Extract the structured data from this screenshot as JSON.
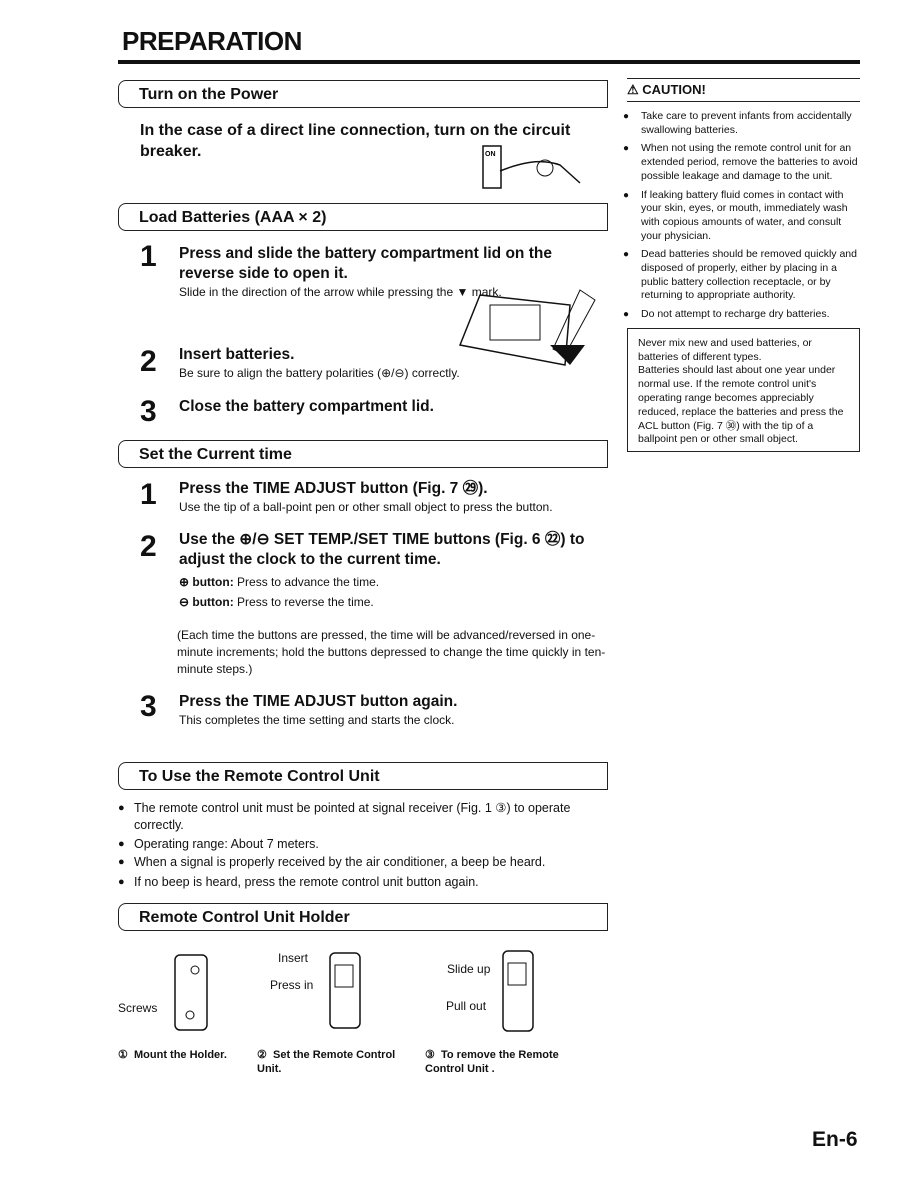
{
  "title": "PREPARATION",
  "power": {
    "header": "Turn on the Power",
    "text": "In the case of a direct line connection, turn on the circuit breaker.",
    "switch_label": "ON"
  },
  "batteries": {
    "header": "Load Batteries (AAA × 2)",
    "steps": [
      {
        "num": "1",
        "title": "Press and slide the battery compartment lid on the reverse side to open it.",
        "desc": "Slide in the direction of the arrow while pressing the ▼ mark."
      },
      {
        "num": "2",
        "title": "Insert batteries.",
        "desc": "Be sure to align the battery polarities (⊕/⊖) correctly."
      },
      {
        "num": "3",
        "title": "Close the battery compartment lid.",
        "desc": ""
      }
    ]
  },
  "time": {
    "header": "Set the Current time",
    "steps": [
      {
        "num": "1",
        "title": "Press the TIME ADJUST button (Fig. 7 ㉙).",
        "desc": "Use the tip of a ball-point pen or other small object to press the button."
      },
      {
        "num": "2",
        "title": "Use the ⊕/⊖ SET TEMP./SET TIME buttons (Fig. 6 ㉒) to adjust the clock to the current time.",
        "plus_label": "⊕ button:",
        "plus_desc": "Press to advance the time.",
        "minus_label": "⊖ button:",
        "minus_desc": "Press to reverse the time.",
        "note": "(Each time the buttons are pressed, the time will be advanced/reversed in one-minute increments; hold the buttons depressed to change the time quickly in ten-minute steps.)"
      },
      {
        "num": "3",
        "title": "Press the TIME ADJUST button again.",
        "desc": "This completes the time setting and starts the clock."
      }
    ]
  },
  "remote": {
    "header": "To Use the Remote Control Unit",
    "bullets": [
      "The remote control unit must be pointed at signal receiver (Fig. 1 ③) to operate correctly.",
      "Operating range: About 7 meters.",
      "When a signal is properly received by the air conditioner, a beep be heard.",
      "If no beep is heard, press the remote control unit button again."
    ]
  },
  "holder": {
    "header": "Remote Control Unit Holder",
    "fig1": {
      "label_screws": "Screws",
      "caption_num": "①",
      "caption": "Mount the Holder."
    },
    "fig2": {
      "label_insert": "Insert",
      "label_press": "Press in",
      "caption_num": "②",
      "caption": "Set the Remote Control Unit."
    },
    "fig3": {
      "label_slide": "Slide up",
      "label_pull": "Pull out",
      "caption_num": "③",
      "caption": "To remove the Remote Control Unit ."
    }
  },
  "caution": {
    "title": "CAUTION!",
    "items": [
      "Take care to prevent infants from accidentally swallowing batteries.",
      "When not using the remote control unit for an extended period, remove the batteries to avoid possible leakage and damage to the unit.",
      "If leaking battery fluid comes in contact with your skin, eyes, or mouth, immediately wash with copious amounts of water, and consult your physician.",
      "Dead batteries should be removed quickly and disposed of properly, either by placing in a public battery collection receptacle, or by returning to appropriate authority.",
      "Do not attempt to recharge dry batteries."
    ],
    "note1": "Never mix new and used batteries, or batteries of different types.",
    "note2": "Batteries should last about one year under normal use. If the remote control unit's operating range becomes appreciably reduced, replace the batteries and press the ACL button (Fig. 7 ㉚) with the tip of a ballpoint pen or other small object."
  },
  "page_number": "En-6"
}
